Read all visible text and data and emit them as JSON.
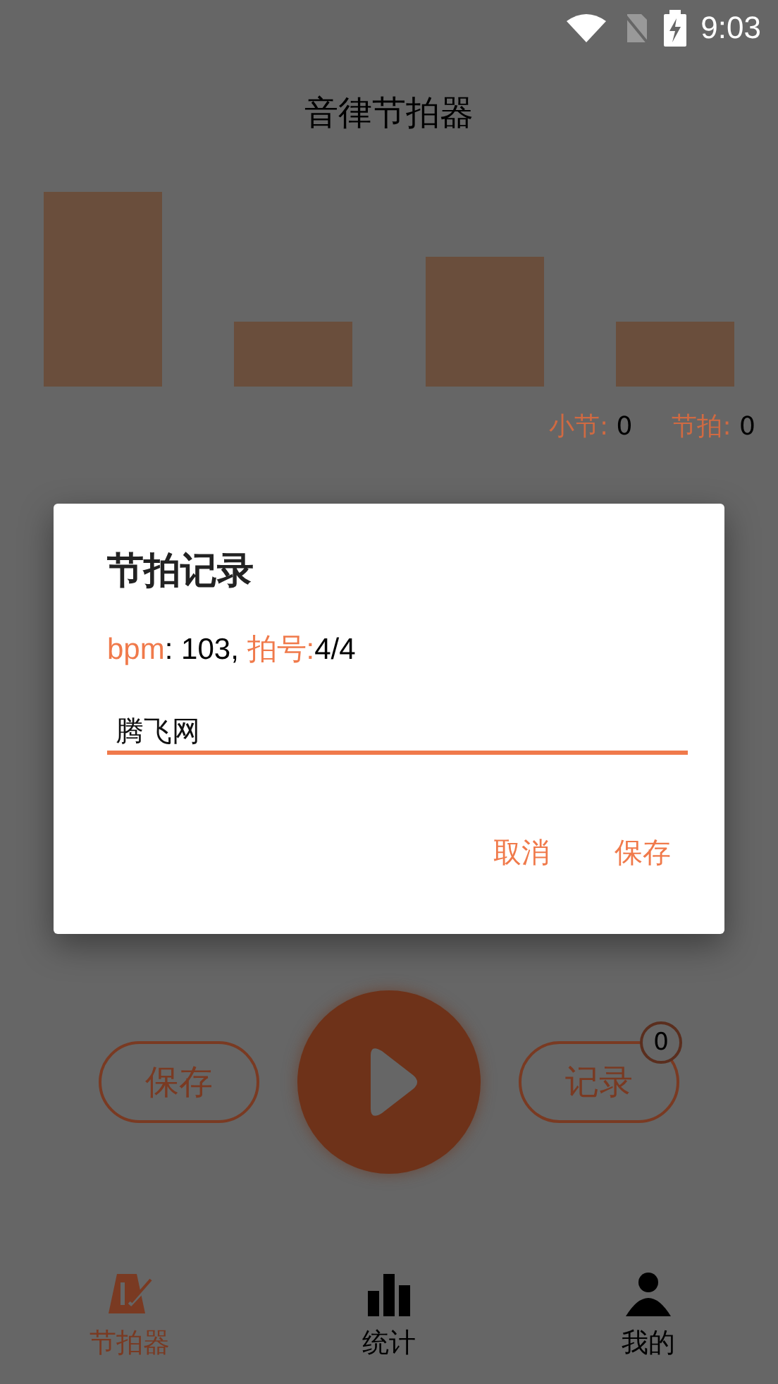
{
  "status_bar": {
    "time": "9:03"
  },
  "title": "音律节拍器",
  "beats": [
    {
      "kind": "strong"
    },
    {
      "kind": "weak"
    },
    {
      "kind": "medium"
    },
    {
      "kind": "weak"
    }
  ],
  "counters": [
    {
      "label": "小节:",
      "value": "0"
    },
    {
      "label": "节拍:",
      "value": "0"
    }
  ],
  "dialog": {
    "title": "节拍记录",
    "info_parts": [
      {
        "text": "bpm",
        "accent": true
      },
      {
        "text": ": 103, ",
        "accent": false
      },
      {
        "text": "拍号:",
        "accent": true
      },
      {
        "text": "4/4",
        "accent": false
      }
    ],
    "value": "腾飞网",
    "buttons": [
      "取消",
      "保存"
    ]
  },
  "controls": {
    "save": "保存",
    "records": "记录",
    "records_badge": "0"
  },
  "nav": [
    {
      "label": "节拍器",
      "selected": true
    },
    {
      "label": "统计",
      "selected": false
    },
    {
      "label": "我的",
      "selected": false
    }
  ]
}
